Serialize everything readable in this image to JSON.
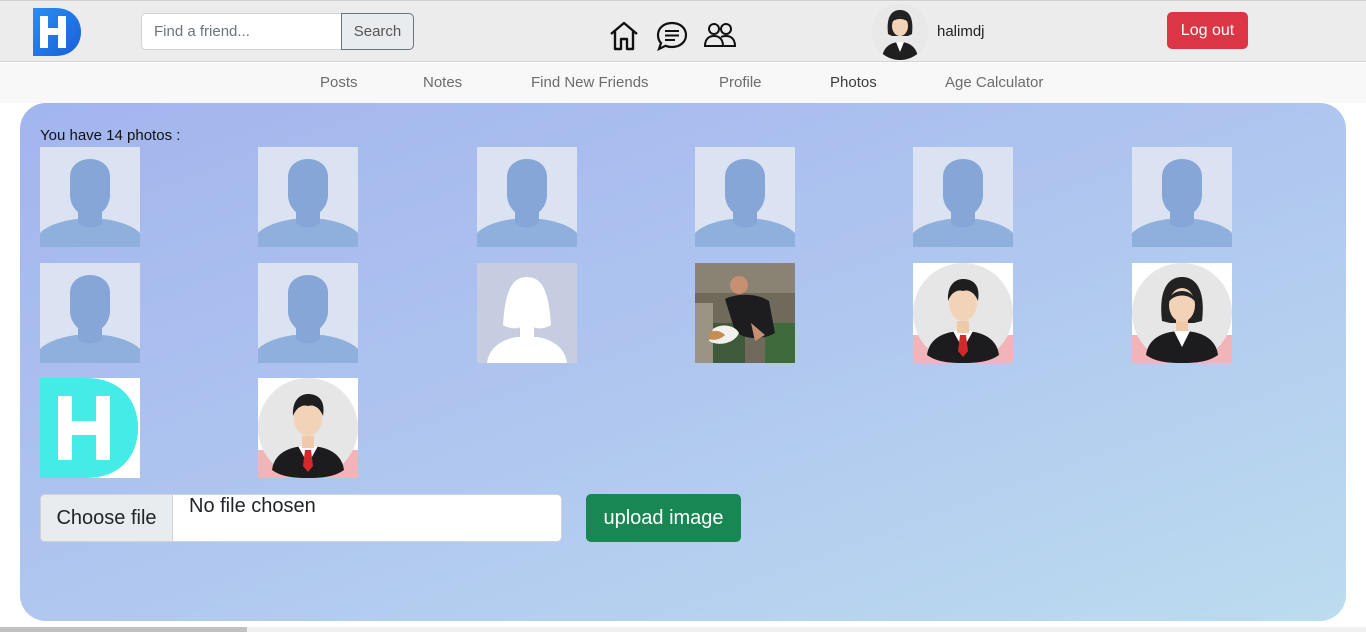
{
  "header": {
    "search_placeholder": "Find a friend...",
    "search_label": "Search",
    "username": "halimdj",
    "logout_label": "Log out",
    "icons": [
      "logo-icon",
      "home-icon",
      "messages-icon",
      "friends-icon",
      "avatar"
    ]
  },
  "menu": [
    {
      "label": "Posts",
      "active": false
    },
    {
      "label": "Notes",
      "active": false
    },
    {
      "label": "Find New Friends",
      "active": false
    },
    {
      "label": "Profile",
      "active": false
    },
    {
      "label": "Photos",
      "active": true
    },
    {
      "label": "Age Calculator",
      "active": false
    }
  ],
  "photos": {
    "count_text": "You have 14 photos :",
    "items": [
      "default-male-avatar",
      "default-male-avatar",
      "default-male-avatar",
      "default-male-avatar",
      "default-male-avatar",
      "default-male-avatar",
      "default-male-avatar",
      "default-male-avatar",
      "default-female-avatar",
      "photo-man-with-dog",
      "businessman-avatar",
      "businesswoman-avatar",
      "logo-image",
      "businessman-avatar"
    ]
  },
  "upload": {
    "choose_label": "Choose file",
    "status": "No file chosen",
    "button_label": "upload image"
  },
  "colors": {
    "logout": "#dc3545",
    "upload": "#198754",
    "card_gradient_start": "#a2b5ee",
    "card_gradient_end": "#bcdcef"
  }
}
